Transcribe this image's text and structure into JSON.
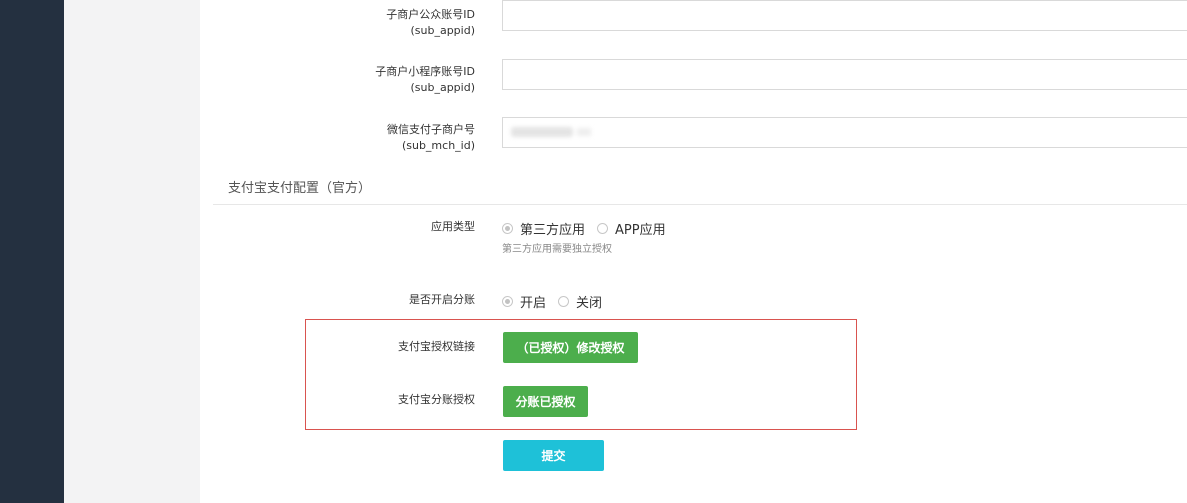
{
  "form": {
    "sub_appid": {
      "label": "子商户公众账号ID",
      "sub": "(sub_appid)",
      "value": ""
    },
    "sub_mini_appid": {
      "label": "子商户小程序账号ID",
      "sub": "(sub_appid)",
      "value": ""
    },
    "sub_mch_id": {
      "label": "微信支付子商户号",
      "sub": "(sub_mch_id)"
    }
  },
  "alipay": {
    "section_title": "支付宝支付配置（官方）",
    "app_type": {
      "label": "应用类型",
      "options": [
        "第三方应用",
        "APP应用"
      ],
      "selected": "第三方应用",
      "help": "第三方应用需要独立授权"
    },
    "split": {
      "label": "是否开启分账",
      "options": [
        "开启",
        "关闭"
      ],
      "selected": "开启"
    },
    "auth_link": {
      "label": "支付宝授权链接",
      "button": "（已授权）修改授权"
    },
    "split_auth": {
      "label": "支付宝分账授权",
      "button": "分账已授权"
    }
  },
  "submit_label": "提交",
  "colors": {
    "sidebar": "#243040",
    "green": "#4cae4c",
    "submit": "#1ec1d8",
    "highlight_border": "#d9534f"
  }
}
